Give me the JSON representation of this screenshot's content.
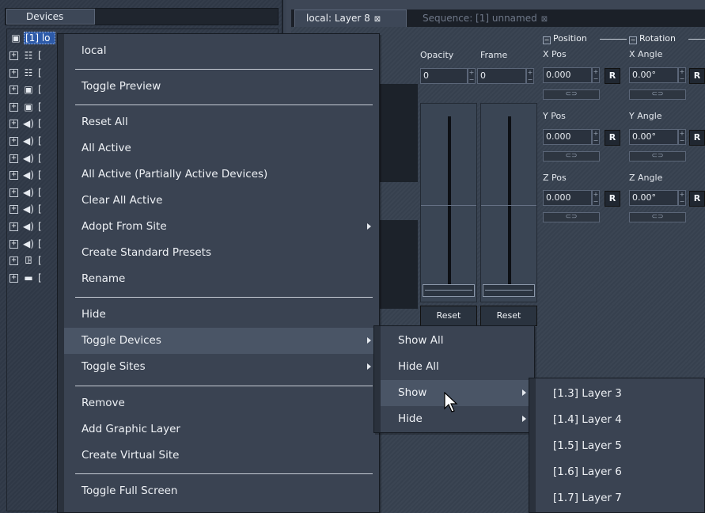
{
  "devices_panel": {
    "tab_label": "Devices",
    "root_item_label": "[1] lo",
    "tree_rows": [
      {
        "icon": "☷",
        "icon_name": "grid-device-icon",
        "label": "["
      },
      {
        "icon": "☷",
        "icon_name": "grid-device-icon",
        "label": "["
      },
      {
        "icon": "▣",
        "icon_name": "image-device-icon",
        "label": "["
      },
      {
        "icon": "▣",
        "icon_name": "image-device-icon",
        "label": "["
      },
      {
        "icon": "◀)",
        "icon_name": "speaker-icon",
        "label": "["
      },
      {
        "icon": "◀)",
        "icon_name": "speaker-icon",
        "label": "["
      },
      {
        "icon": "◀)",
        "icon_name": "speaker-icon",
        "label": "["
      },
      {
        "icon": "◀)",
        "icon_name": "speaker-icon",
        "label": "["
      },
      {
        "icon": "◀)",
        "icon_name": "speaker-icon",
        "label": "["
      },
      {
        "icon": "◀)",
        "icon_name": "speaker-icon",
        "label": "["
      },
      {
        "icon": "◀)",
        "icon_name": "speaker-icon",
        "label": "["
      },
      {
        "icon": "◀)",
        "icon_name": "speaker-icon",
        "label": "["
      },
      {
        "icon": "ꖸ",
        "icon_name": "projector-icon",
        "label": "["
      },
      {
        "icon": "▬",
        "icon_name": "monitor-icon",
        "label": "["
      }
    ]
  },
  "tabs": {
    "layer_tab": "local: Layer 8",
    "sequence_tab": "Sequence: [1] unnamed",
    "close_glyph": "⊠"
  },
  "layer_panel": {
    "opacity_label": "Opacity",
    "opacity_value": "0",
    "frame_label": "Frame",
    "frame_value": "0",
    "position_group": "Position",
    "rotation_group": "Rotation",
    "x_pos_label": "X Pos",
    "x_pos_value": "0.000",
    "y_pos_label": "Y Pos",
    "y_pos_value": "0.000",
    "z_pos_label": "Z Pos",
    "z_pos_value": "0.000",
    "x_angle_label": "X Angle",
    "x_angle_value": "0.00°",
    "y_angle_label": "Y Angle",
    "y_angle_value": "0.00°",
    "z_angle_label": "Z Angle",
    "z_angle_value": "0.00°",
    "r_label": "R",
    "reset_label": "Reset",
    "link_glyph": "⊂⊃"
  },
  "main_menu": {
    "items": [
      {
        "label": "local",
        "submenu": false
      },
      {
        "label": "Toggle Preview",
        "submenu": false
      },
      {
        "label": "Reset All",
        "submenu": false
      },
      {
        "label": "All Active",
        "submenu": false
      },
      {
        "label": "All Active (Partially Active Devices)",
        "submenu": false
      },
      {
        "label": "Clear All Active",
        "submenu": false
      },
      {
        "label": "Adopt From Site",
        "submenu": true
      },
      {
        "label": "Create Standard Presets",
        "submenu": false
      },
      {
        "label": "Rename",
        "submenu": false
      },
      {
        "label": "Hide",
        "submenu": false
      },
      {
        "label": "Toggle Devices",
        "submenu": true,
        "highlighted": true
      },
      {
        "label": "Toggle Sites",
        "submenu": true
      },
      {
        "label": "Remove",
        "submenu": false
      },
      {
        "label": "Add Graphic Layer",
        "submenu": false
      },
      {
        "label": "Create Virtual Site",
        "submenu": false
      },
      {
        "label": "Toggle Full Screen",
        "submenu": false
      }
    ]
  },
  "toggle_devices_menu": {
    "items": [
      {
        "label": "Show All",
        "submenu": false
      },
      {
        "label": "Hide All",
        "submenu": false
      },
      {
        "label": "Show",
        "submenu": true,
        "highlighted": true
      },
      {
        "label": "Hide",
        "submenu": true
      }
    ]
  },
  "show_menu": {
    "items": [
      {
        "label": "[1.3] Layer 3"
      },
      {
        "label": "[1.4] Layer 4"
      },
      {
        "label": "[1.5] Layer 5"
      },
      {
        "label": "[1.6] Layer 6"
      },
      {
        "label": "[1.7] Layer 7"
      }
    ]
  },
  "colors": {
    "panel_bg": "#3a4352",
    "menu_highlight": "#4a5566",
    "selection_blue": "#2d5aa8"
  }
}
